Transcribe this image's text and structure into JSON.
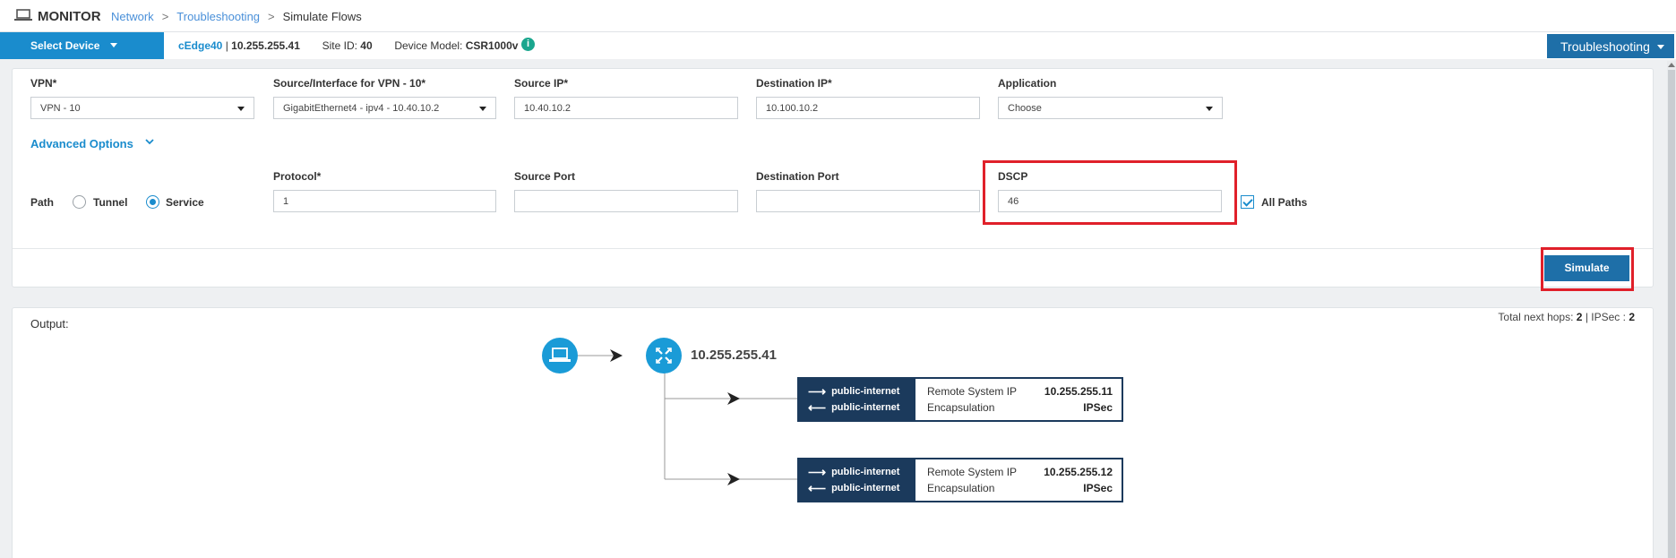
{
  "header": {
    "title": "MONITOR",
    "breadcrumbs": [
      "Network",
      "Troubleshooting",
      "Simulate Flows"
    ],
    "separator": ">"
  },
  "device_bar": {
    "select_label": "Select Device",
    "device_name": "cEdge40",
    "device_ip": "10.255.255.41",
    "site_label": "Site ID:",
    "site_id": "40",
    "model_label": "Device Model:",
    "model": "CSR1000v",
    "info": "i",
    "troubleshooting_label": "Troubleshooting"
  },
  "form": {
    "vpn": {
      "label": "VPN*",
      "value": "VPN - 10"
    },
    "source_interface": {
      "label": "Source/Interface for VPN - 10*",
      "value": "GigabitEthernet4 - ipv4 - 10.40.10.2"
    },
    "source_ip": {
      "label": "Source IP*",
      "value": "10.40.10.2"
    },
    "destination_ip": {
      "label": "Destination IP*",
      "value": "10.100.10.2"
    },
    "application": {
      "label": "Application",
      "value": "Choose"
    },
    "advanced_options": "Advanced Options",
    "path": {
      "label": "Path",
      "options": [
        "Tunnel",
        "Service"
      ],
      "selected": "Service"
    },
    "protocol": {
      "label": "Protocol*",
      "value": "1"
    },
    "source_port": {
      "label": "Source Port",
      "value": ""
    },
    "destination_port": {
      "label": "Destination Port",
      "value": ""
    },
    "dscp": {
      "label": "DSCP",
      "value": "46"
    },
    "all_paths": {
      "label": "All Paths",
      "checked": true
    },
    "simulate_label": "Simulate"
  },
  "output": {
    "label": "Output:",
    "hops_prefix": "Total next hops:",
    "total_hops": "2",
    "ipsec_prefix": "| IPSec :",
    "ipsec": "2",
    "router_ip": "10.255.255.41",
    "hops": [
      {
        "tx": "public-internet",
        "rx": "public-internet",
        "remote_label": "Remote System IP",
        "remote_ip": "10.255.255.11",
        "encap_label": "Encapsulation",
        "encap": "IPSec"
      },
      {
        "tx": "public-internet",
        "rx": "public-internet",
        "remote_label": "Remote System IP",
        "remote_ip": "10.255.255.12",
        "encap_label": "Encapsulation",
        "encap": "IPSec"
      }
    ]
  },
  "colors": {
    "primary": "#1a8ccd",
    "button": "#1e6fa8",
    "tunnel_box": "#1b3a5c",
    "highlight": "#e0202a"
  },
  "icons": [
    "laptop-icon",
    "router-icon",
    "chevron-down-icon",
    "info-icon",
    "arrow-right-icon",
    "arrow-left-icon"
  ]
}
